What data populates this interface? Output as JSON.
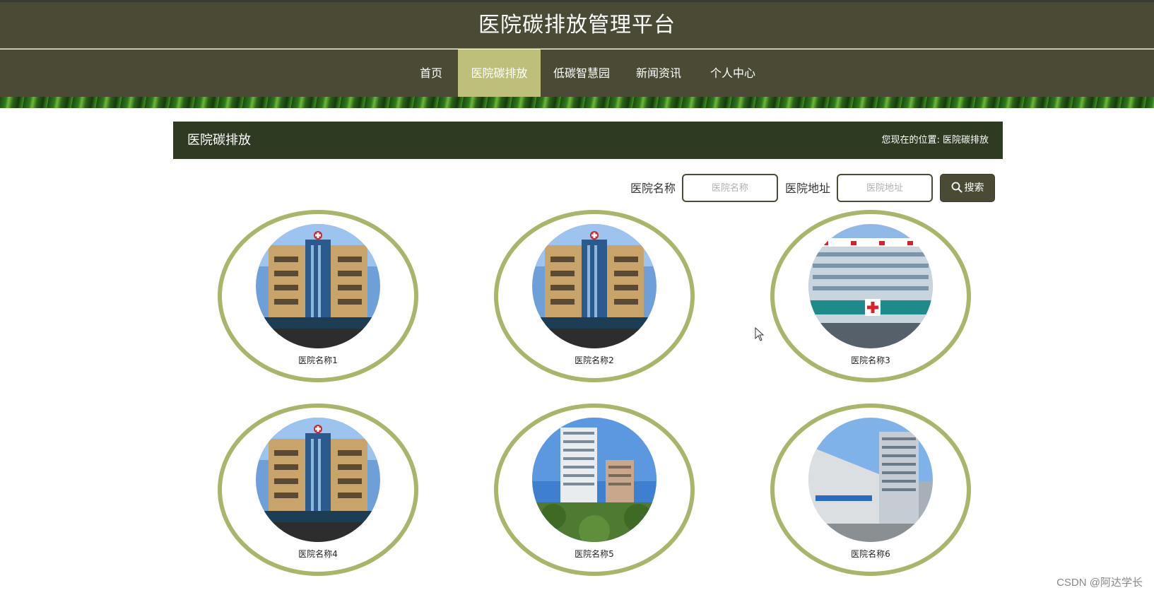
{
  "header": {
    "site_title": "医院碳排放管理平台"
  },
  "nav": {
    "items": [
      {
        "label": "首页"
      },
      {
        "label": "医院碳排放"
      },
      {
        "label": "低碳智慧园"
      },
      {
        "label": "新闻资讯"
      },
      {
        "label": "个人中心"
      }
    ],
    "active_index": 1
  },
  "section": {
    "title": "医院碳排放",
    "breadcrumb_prefix": "您现在的位置:",
    "breadcrumb_current": "医院碳排放"
  },
  "search": {
    "name_label": "医院名称",
    "name_placeholder": "医院名称",
    "address_label": "医院地址",
    "address_placeholder": "医院地址",
    "button_label": "搜索"
  },
  "hospitals": [
    {
      "name": "医院名称1",
      "image": "hospital-building-photo"
    },
    {
      "name": "医院名称2",
      "image": "hospital-building-photo"
    },
    {
      "name": "医院名称3",
      "image": "hospital-building-photo"
    },
    {
      "name": "医院名称4",
      "image": "hospital-building-photo"
    },
    {
      "name": "医院名称5",
      "image": "hospital-building-photo"
    },
    {
      "name": "医院名称6",
      "image": "hospital-building-photo"
    }
  ],
  "watermark": "CSDN @阿达学长",
  "colors": {
    "header_bg": "#4a4a35",
    "nav_active_bg": "#bdbf7a",
    "section_bar_bg": "#2f3a22",
    "card_ring": "#a8b56a"
  }
}
